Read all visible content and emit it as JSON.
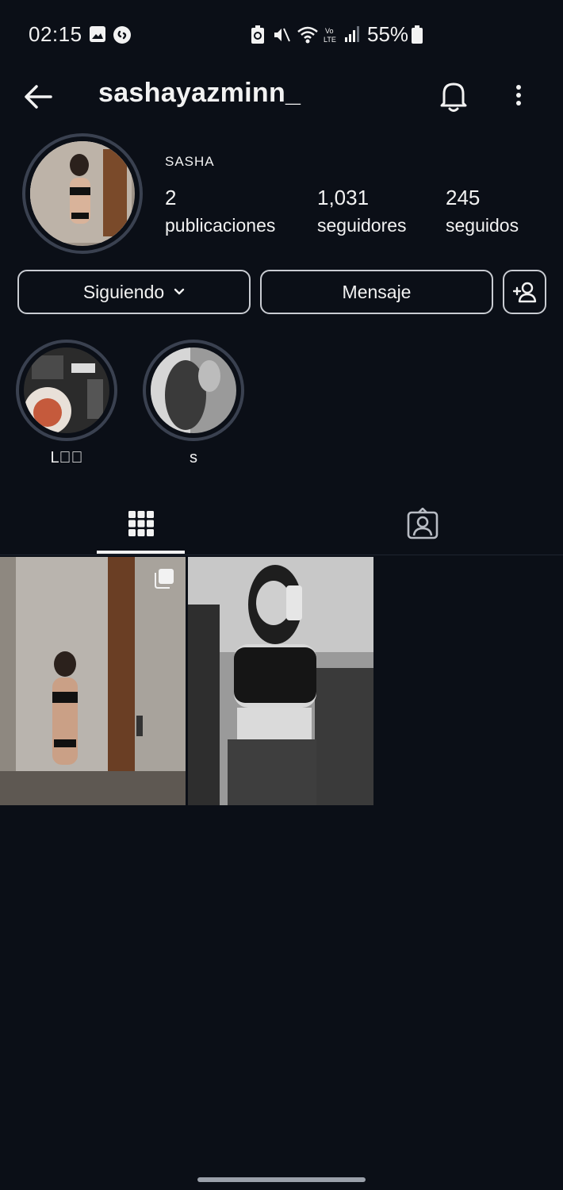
{
  "status_bar": {
    "time": "02:15",
    "battery": "55%"
  },
  "header": {
    "username": "sashayazminn_"
  },
  "profile": {
    "display_name": "SASHA",
    "stats": [
      {
        "value": "2",
        "label": "publicaciones"
      },
      {
        "value": "1,031",
        "label": "seguidores"
      },
      {
        "value": "245",
        "label": "seguidos"
      }
    ]
  },
  "actions": {
    "following_label": "Siguiendo",
    "message_label": "Mensaje"
  },
  "highlights": [
    {
      "label": "L🅂🏼"
    },
    {
      "label": "s"
    }
  ],
  "tabs": [
    {
      "icon": "grid-icon",
      "selected": true
    },
    {
      "icon": "tagged-icon",
      "selected": false
    }
  ],
  "colors": {
    "background": "#0b0f17",
    "text": "#f2f2f2",
    "ring": "#3a4150"
  }
}
